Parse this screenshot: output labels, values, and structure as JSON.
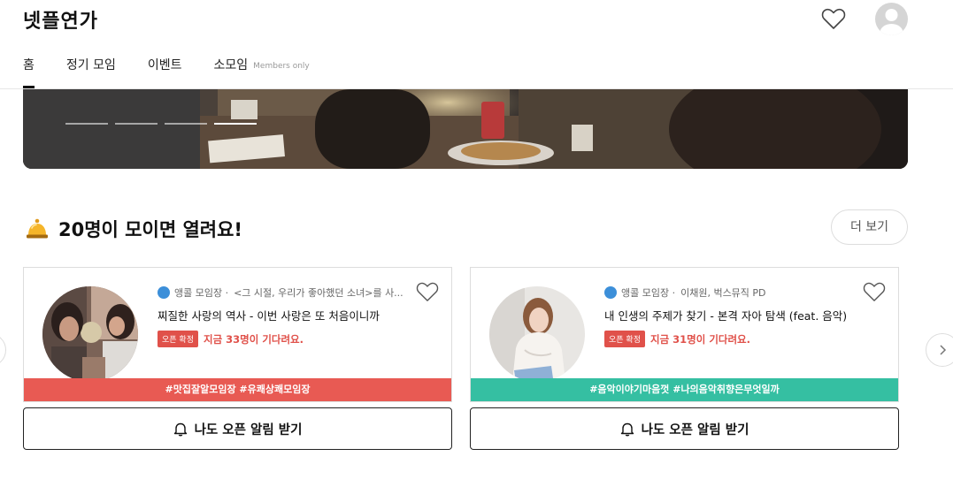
{
  "header": {
    "logo": "넷플연가",
    "nav": [
      {
        "label": "홈",
        "active": true
      },
      {
        "label": "정기 모임"
      },
      {
        "label": "이벤트"
      },
      {
        "label": "소모임",
        "sub": "Members only"
      }
    ]
  },
  "banner": {
    "slides": 4,
    "active_slide": 4
  },
  "section": {
    "title": "20명이 모이면 열려요!",
    "more_label": "더 보기"
  },
  "cards": [
    {
      "host_label": "앵콜 모임장 ·",
      "host_name": "<그 시절, 우리가 좋아했던 소녀>를 사...",
      "title": "찌질한 사랑의 역사 - 이번 사랑은 또 처음이니까",
      "badge": "오픈 확정",
      "wait_text": "지금 33명이 기다려요.",
      "tags": "#맛집잘알모임장 #유쾌상쾌모임장",
      "tag_color": "#e85a53",
      "button_label": "나도 오픈 알림 받기"
    },
    {
      "host_label": "앵콜 모임장 ·",
      "host_name": "이채원, 벅스뮤직 PD",
      "title": "내 인생의 주제가 찾기 - 본격 자아 탐색 (feat. 음악)",
      "badge": "오픈 확정",
      "wait_text": "지금 31명이 기다려요.",
      "tags": "#음악이야기마음껏 #나의음악취향은무엇일까",
      "tag_color": "#35bfa2",
      "button_label": "나도 오픈 알림 받기"
    }
  ],
  "icons": {
    "heart": "heart-icon",
    "bell": "bell-icon",
    "arrow_left": "chevron-left-icon",
    "arrow_right": "chevron-right-icon"
  }
}
